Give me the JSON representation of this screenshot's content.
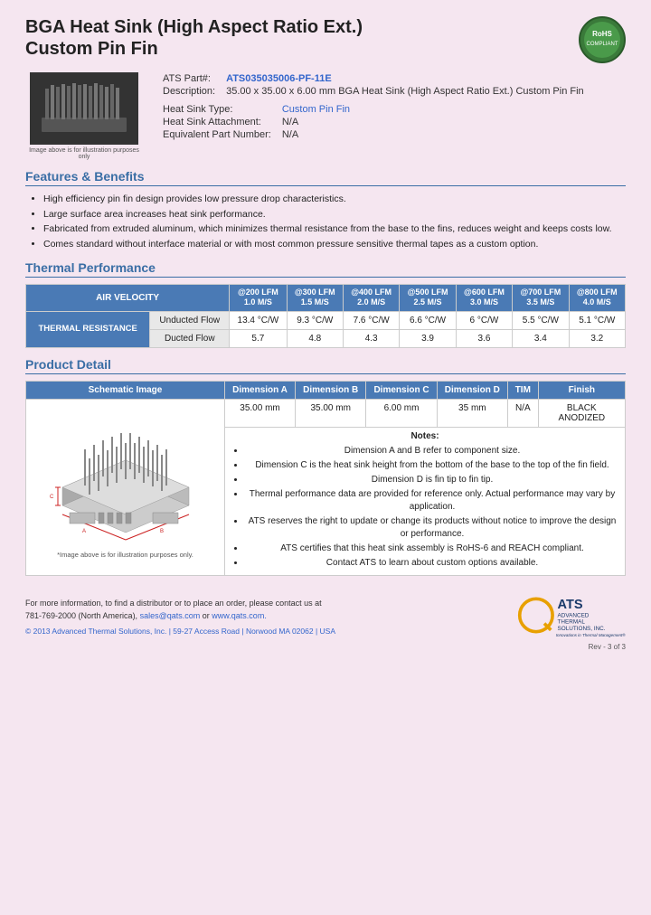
{
  "title_line1": "BGA Heat Sink (High Aspect Ratio Ext.)",
  "title_line2": "Custom Pin Fin",
  "part_info": {
    "ats_part_label": "ATS Part#:",
    "ats_part_value": "ATS035035006-PF-11E",
    "description_label": "Description:",
    "description_value": "35.00 x 35.00 x 6.00 mm  BGA Heat Sink (High Aspect Ratio Ext.) Custom Pin Fin",
    "heat_sink_type_label": "Heat Sink Type:",
    "heat_sink_type_value": "Custom Pin Fin",
    "heat_sink_attachment_label": "Heat Sink Attachment:",
    "heat_sink_attachment_value": "N/A",
    "equivalent_part_label": "Equivalent Part Number:",
    "equivalent_part_value": "N/A"
  },
  "image_caption": "Image above is for illustration purposes only",
  "features_title": "Features & Benefits",
  "features": [
    "High efficiency pin fin design provides low pressure drop characteristics.",
    "Large surface area increases heat sink performance.",
    "Fabricated from extruded aluminum, which minimizes thermal resistance from the base to the fins, reduces weight and keeps costs low.",
    "Comes standard without interface material or with most common pressure sensitive thermal tapes as a custom option."
  ],
  "thermal_title": "Thermal Performance",
  "thermal_table": {
    "col_air_velocity": "AIR VELOCITY",
    "cols": [
      {
        "lfm": "@200 LFM",
        "ms": "1.0 M/S"
      },
      {
        "lfm": "@300 LFM",
        "ms": "1.5 M/S"
      },
      {
        "lfm": "@400 LFM",
        "ms": "2.0 M/S"
      },
      {
        "lfm": "@500 LFM",
        "ms": "2.5 M/S"
      },
      {
        "lfm": "@600 LFM",
        "ms": "3.0 M/S"
      },
      {
        "lfm": "@700 LFM",
        "ms": "3.5 M/S"
      },
      {
        "lfm": "@800 LFM",
        "ms": "4.0 M/S"
      }
    ],
    "row_label": "THERMAL RESISTANCE",
    "rows": [
      {
        "sublabel": "Unducted Flow",
        "values": [
          "13.4 °C/W",
          "9.3 °C/W",
          "7.6 °C/W",
          "6.6 °C/W",
          "6 °C/W",
          "5.5 °C/W",
          "5.1 °C/W"
        ]
      },
      {
        "sublabel": "Ducted Flow",
        "values": [
          "5.7",
          "4.8",
          "4.3",
          "3.9",
          "3.6",
          "3.4",
          "3.2"
        ]
      }
    ]
  },
  "product_detail_title": "Product Detail",
  "product_detail": {
    "col_schematic": "Schematic Image",
    "col_a": "Dimension A",
    "col_b": "Dimension B",
    "col_c": "Dimension C",
    "col_d": "Dimension D",
    "col_tim": "TIM",
    "col_finish": "Finish",
    "dim_a": "35.00 mm",
    "dim_b": "35.00 mm",
    "dim_c": "6.00 mm",
    "dim_d": "35 mm",
    "tim": "N/A",
    "finish": "BLACK ANODIZED"
  },
  "notes_title": "Notes:",
  "notes": [
    "Dimension A and B refer to component size.",
    "Dimension C is the heat sink height from the bottom of the base to the top of the fin field.",
    "Dimension D is fin tip to fin tip.",
    "Thermal performance data are provided for reference only. Actual performance may vary by application.",
    "ATS reserves the right to update or change its products without notice to improve the design or performance.",
    "ATS certifies that this heat sink assembly is RoHS-6 and REACH compliant.",
    "Contact ATS to learn about custom options available."
  ],
  "schematic_caption": "*Image above is for illustration purposes only.",
  "footer": {
    "contact_text": "For more information, to find a distributor or to place an order, please contact us at",
    "phone": "781-769-2000 (North America),",
    "email": "sales@qats.com",
    "or_text": "or",
    "website": "www.qats.com.",
    "copyright": "© 2013 Advanced Thermal Solutions, Inc. | 59-27 Access Road | Norwood MA  02062 | USA",
    "page_num": "Rev - 3 of 3"
  }
}
